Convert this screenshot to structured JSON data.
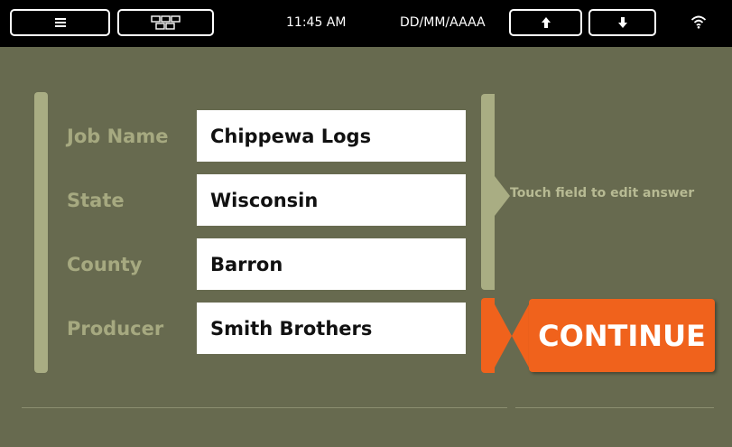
{
  "status_bar": {
    "menu_icon": "hamburger-menu-icon",
    "grid_icon": "grid-layout-icon",
    "time": "11:45 AM",
    "date_format": "DD/MM/AAAA",
    "up_icon": "arrow-up-icon",
    "down_icon": "arrow-down-icon",
    "wifi_icon": "wifi-icon"
  },
  "form": {
    "fields": [
      {
        "label": "Job Name",
        "value": "Chippewa Logs"
      },
      {
        "label": "State",
        "value": "Wisconsin"
      },
      {
        "label": "County",
        "value": "Barron"
      },
      {
        "label": "Producer",
        "value": "Smith Brothers"
      }
    ],
    "hint": "Touch field to edit answer"
  },
  "actions": {
    "continue_label": "CONTINUE"
  },
  "colors": {
    "background": "#676a4f",
    "accent": "#f0621c",
    "bracket": "#a9ad83",
    "label": "#a6a980"
  }
}
